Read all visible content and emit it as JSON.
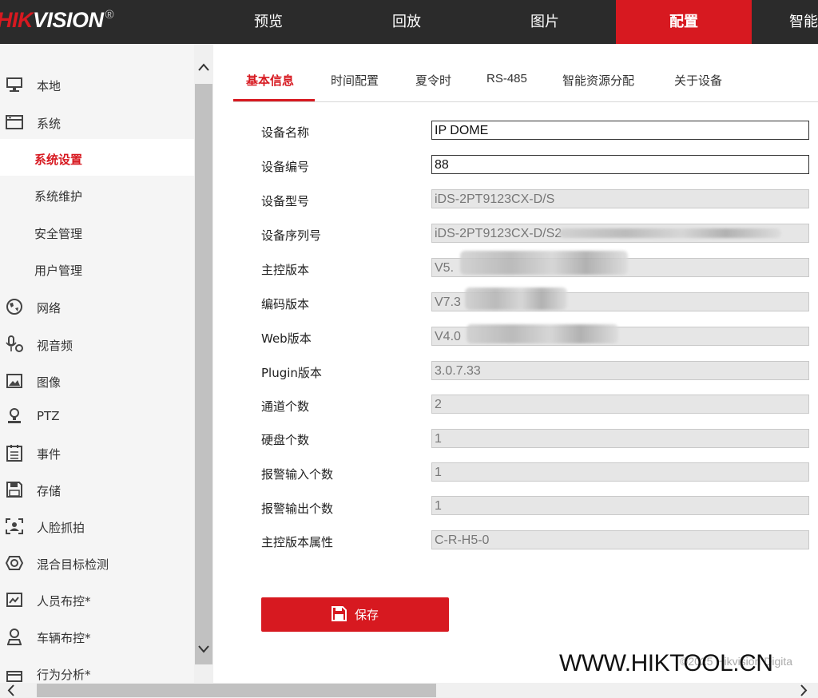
{
  "brand": {
    "logo_red": "HIK",
    "logo_white": "VISION",
    "logo_reg": "®"
  },
  "topnav": {
    "items": [
      {
        "label": "预览"
      },
      {
        "label": "回放"
      },
      {
        "label": "图片"
      },
      {
        "label": "配置",
        "active": true
      },
      {
        "label": "智能"
      }
    ]
  },
  "sidebar": {
    "items": [
      {
        "label": "本地",
        "icon": "monitor-icon"
      },
      {
        "label": "系统",
        "icon": "system-icon"
      },
      {
        "label": "系统设置",
        "sub": true,
        "active": true
      },
      {
        "label": "系统维护",
        "sub": true
      },
      {
        "label": "安全管理",
        "sub": true
      },
      {
        "label": "用户管理",
        "sub": true
      },
      {
        "label": "网络",
        "icon": "globe-icon"
      },
      {
        "label": "视音频",
        "icon": "microphone-icon"
      },
      {
        "label": "图像",
        "icon": "image-icon"
      },
      {
        "label": "PTZ",
        "icon": "ptz-icon"
      },
      {
        "label": "事件",
        "icon": "calendar-icon"
      },
      {
        "label": "存储",
        "icon": "floppy-icon"
      },
      {
        "label": "人脸抓拍",
        "icon": "face-capture-icon"
      },
      {
        "label": "混合目标检测",
        "icon": "mixed-detection-icon"
      },
      {
        "label": "人员布控*",
        "icon": "person-monitor-icon"
      },
      {
        "label": "车辆布控*",
        "icon": "vehicle-monitor-icon"
      },
      {
        "label": "行为分析*",
        "icon": "behavior-analysis-icon"
      }
    ]
  },
  "tabs": [
    {
      "label": "基本信息",
      "active": true
    },
    {
      "label": "时间配置"
    },
    {
      "label": "夏令时"
    },
    {
      "label": "RS-485"
    },
    {
      "label": "智能资源分配"
    },
    {
      "label": "关于设备"
    }
  ],
  "form": {
    "fields": [
      {
        "label": "设备名称",
        "value": "IP DOME",
        "editable": true
      },
      {
        "label": "设备编号",
        "value": "88",
        "editable": true
      },
      {
        "label": "设备型号",
        "value": "iDS-2PT9123CX-D/S"
      },
      {
        "label": "设备序列号",
        "value": "iDS-2PT9123CX-D/S2"
      },
      {
        "label": "主控版本",
        "value": "V5."
      },
      {
        "label": "编码版本",
        "value": "V7.3"
      },
      {
        "label": "Web版本",
        "value": "V4.0"
      },
      {
        "label": "Plugin版本",
        "value": "3.0.7.33"
      },
      {
        "label": "通道个数",
        "value": "2"
      },
      {
        "label": "硬盘个数",
        "value": "1"
      },
      {
        "label": "报警输入个数",
        "value": "1"
      },
      {
        "label": "报警输出个数",
        "value": "1"
      },
      {
        "label": "主控版本属性",
        "value": "C-R-H5-0"
      }
    ]
  },
  "save_button": {
    "label": "保存",
    "icon": "floppy-icon"
  },
  "footer": {
    "copyright": "©2025 Hikvision Digita",
    "watermark": "WWW.HIKTOOL.CN"
  },
  "colors": {
    "accent": "#d71920",
    "topbar": "#2b2b2b",
    "sidebar_bg": "#f5f5f5"
  }
}
